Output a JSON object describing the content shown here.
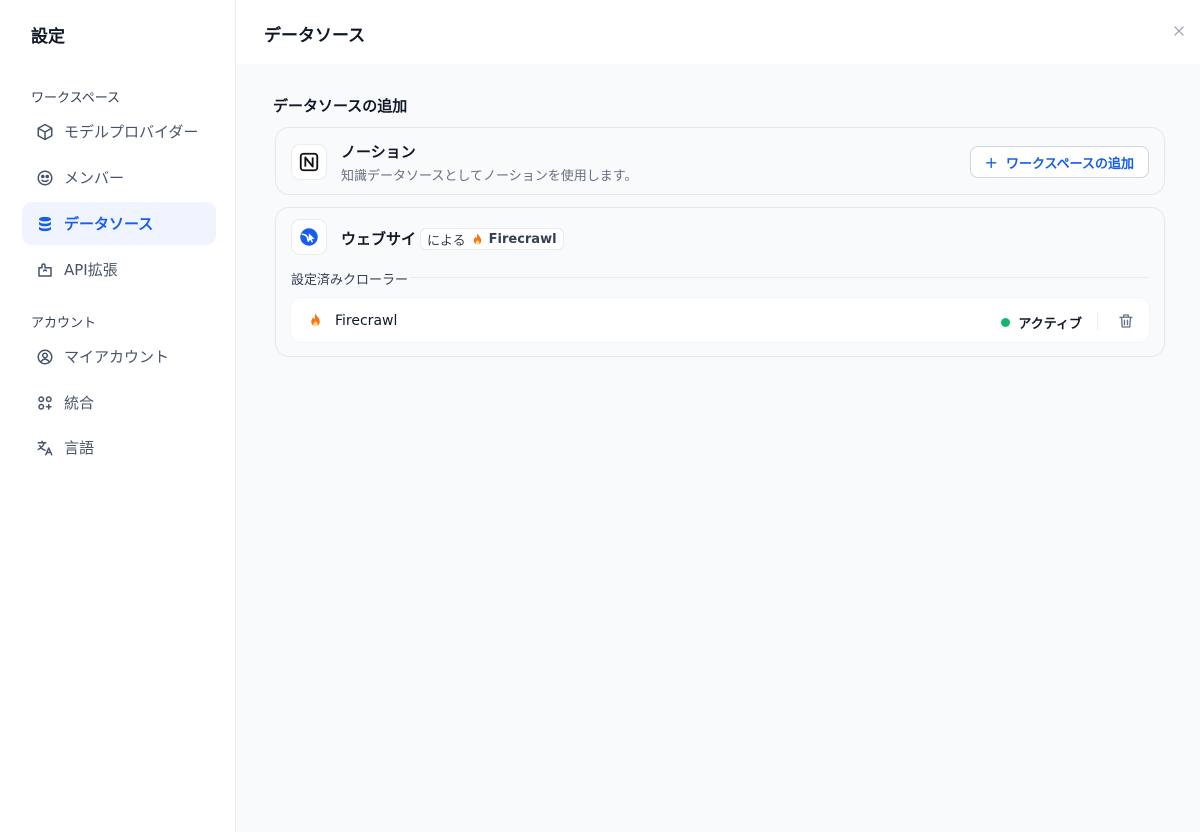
{
  "sidebar": {
    "title": "設定",
    "sections": {
      "workspace": "ワークスペース",
      "account": "アカウント"
    },
    "items": [
      {
        "label": "モデルプロバイダー",
        "icon": "cube-icon"
      },
      {
        "label": "メンバー",
        "icon": "members-icon"
      },
      {
        "label": "データソース",
        "icon": "database-icon",
        "active": true
      },
      {
        "label": "API拡張",
        "icon": "puzzle-icon"
      },
      {
        "label": "マイアカウント",
        "icon": "user-circle-icon"
      },
      {
        "label": "統合",
        "icon": "integrations-icon"
      },
      {
        "label": "言語",
        "icon": "translate-icon"
      }
    ]
  },
  "header": {
    "title": "データソース",
    "close_icon": "close-icon"
  },
  "main": {
    "section_title": "データソースの追加",
    "notion": {
      "title": "ノーション",
      "description": "知識データソースとしてノーションを使用します。",
      "button_label": "ワークスペースの追加",
      "button_plus": "+"
    },
    "website": {
      "title": "ウェブサイト",
      "by_prefix": "による",
      "by_brand": "Firecrawl",
      "crawler_section_label": "設定済みクローラー",
      "crawlers": [
        {
          "name": "Firecrawl",
          "status": "アクティブ"
        }
      ]
    }
  },
  "colors": {
    "accent": "#155eef",
    "active_bg": "#eff4ff",
    "status_active": "#12b76a",
    "fire": "#f97316"
  }
}
